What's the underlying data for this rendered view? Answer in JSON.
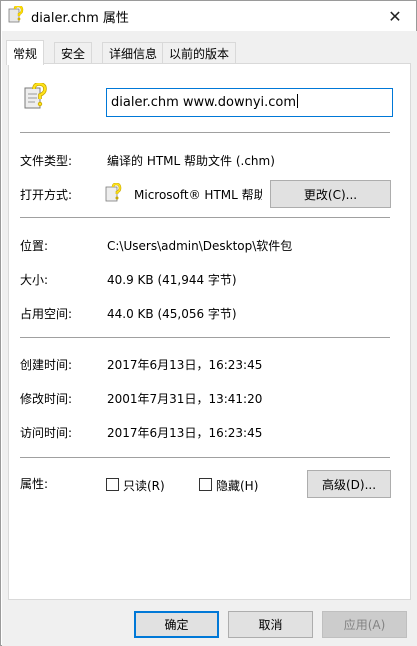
{
  "window": {
    "title": "dialer.chm 属性",
    "close_glyph": "✕"
  },
  "tabs": [
    {
      "label": "常规",
      "active": true
    },
    {
      "label": "安全",
      "active": false
    },
    {
      "label": "详细信息",
      "active": false
    },
    {
      "label": "以前的版本",
      "active": false
    }
  ],
  "general": {
    "file_name": "dialer.chm www.downyi.com",
    "file_type_label": "文件类型:",
    "file_type_value": "编译的 HTML 帮助文件 (.chm)",
    "opens_with_label": "打开方式:",
    "opens_with_value": "Microsoft® HTML 帮助",
    "change_button": "更改(C)...",
    "location_label": "位置:",
    "location_value": "C:\\Users\\admin\\Desktop\\软件包",
    "size_label": "大小:",
    "size_value": "40.9 KB (41,944 字节)",
    "size_on_disk_label": "占用空间:",
    "size_on_disk_value": "44.0 KB (45,056 字节)",
    "created_label": "创建时间:",
    "created_value": "2017年6月13日，16:23:45",
    "modified_label": "修改时间:",
    "modified_value": "2001年7月31日，13:41:20",
    "accessed_label": "访问时间:",
    "accessed_value": "2017年6月13日，16:23:45",
    "attributes_label": "属性:",
    "readonly_label": "只读(R)",
    "readonly_checked": false,
    "hidden_label": "隐藏(H)",
    "hidden_checked": false,
    "advanced_button": "高级(D)..."
  },
  "footer": {
    "ok": "确定",
    "cancel": "取消",
    "apply": "应用(A)"
  },
  "colors": {
    "accent": "#0078d7",
    "dialog_bg": "#f0f0f0",
    "separator": "#a0a0a0"
  },
  "icons": {
    "title": "chm-help-file-icon",
    "file": "chm-help-file-icon",
    "opens_with": "chm-help-file-icon"
  }
}
